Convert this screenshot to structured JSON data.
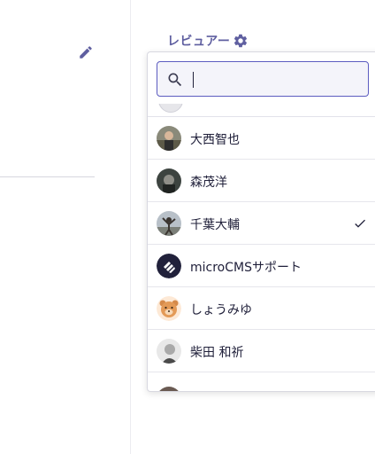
{
  "left_panel": {
    "edit_icon": "pencil-icon"
  },
  "reviewer": {
    "label": "レビュアー",
    "settings_icon": "gear-icon"
  },
  "search": {
    "value": "",
    "icon": "search-icon"
  },
  "colors": {
    "accent": "#5f5fa0",
    "input_border": "#5c5cc0",
    "input_bg": "#f4f4fa"
  },
  "members": [
    {
      "name": "大西智也",
      "avatar": "photo-avatar",
      "selected": false
    },
    {
      "name": "森茂洋",
      "avatar": "photo-avatar",
      "selected": false
    },
    {
      "name": "千葉大輔",
      "avatar": "photo-avatar",
      "selected": true
    },
    {
      "name": "microCMSサポート",
      "avatar": "microcms-logo-avatar",
      "selected": false
    },
    {
      "name": "しょうみゆ",
      "avatar": "bear-avatar",
      "selected": false
    },
    {
      "name": "柴田 和祈",
      "avatar": "photo-avatar",
      "selected": false
    }
  ]
}
